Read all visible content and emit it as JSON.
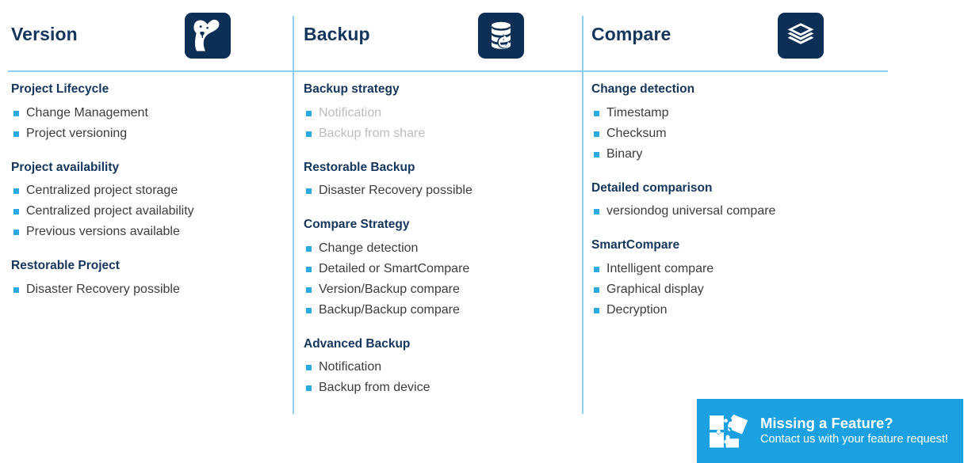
{
  "colors": {
    "heading_navy": "#14365c",
    "bullet_cyan": "#29aae1",
    "divider_blue": "#8ed0f2",
    "banner_blue": "#1ba1e2",
    "icon_tile_navy": "#0c2f55",
    "body_text": "#3c3c3c",
    "dim_text": "#bdbdbd"
  },
  "columns": [
    {
      "title": "Version",
      "icon": "versiondog-dog-icon",
      "groups": [
        {
          "title": "Project Lifecycle",
          "items": [
            {
              "label": "Change Management",
              "dim": false
            },
            {
              "label": "Project versioning",
              "dim": false
            }
          ]
        },
        {
          "title": "Project availability",
          "items": [
            {
              "label": "Centralized project storage",
              "dim": false
            },
            {
              "label": "Centralized project availability",
              "dim": false
            },
            {
              "label": "Previous versions available",
              "dim": false
            }
          ]
        },
        {
          "title": "Restorable Project",
          "items": [
            {
              "label": "Disaster Recovery possible",
              "dim": false
            }
          ]
        }
      ]
    },
    {
      "title": "Backup",
      "icon": "database-restore-icon",
      "groups": [
        {
          "title": "Backup strategy",
          "items": [
            {
              "label": "Notification",
              "dim": true
            },
            {
              "label": "Backup from share",
              "dim": true
            }
          ]
        },
        {
          "title": "Restorable Backup",
          "items": [
            {
              "label": "Disaster Recovery possible",
              "dim": false
            }
          ]
        },
        {
          "title": "Compare Strategy",
          "items": [
            {
              "label": "Change detection",
              "dim": false
            },
            {
              "label": "Detailed or SmartCompare",
              "dim": false
            },
            {
              "label": "Version/Backup compare",
              "dim": false
            },
            {
              "label": "Backup/Backup compare",
              "dim": false
            }
          ]
        },
        {
          "title": "Advanced Backup",
          "items": [
            {
              "label": "Notification",
              "dim": false
            },
            {
              "label": "Backup from device",
              "dim": false
            }
          ]
        }
      ]
    },
    {
      "title": "Compare",
      "icon": "layers-stack-icon",
      "groups": [
        {
          "title": "Change detection",
          "items": [
            {
              "label": "Timestamp",
              "dim": false
            },
            {
              "label": "Checksum",
              "dim": false
            },
            {
              "label": "Binary",
              "dim": false
            }
          ]
        },
        {
          "title": "Detailed comparison",
          "items": [
            {
              "label": "versiondog universal compare",
              "dim": false
            }
          ]
        },
        {
          "title": "SmartCompare",
          "items": [
            {
              "label": "Intelligent compare",
              "dim": false
            },
            {
              "label": "Graphical display",
              "dim": false
            },
            {
              "label": "Decryption",
              "dim": false
            }
          ]
        }
      ]
    }
  ],
  "feature_banner": {
    "icon": "puzzle-pieces-icon",
    "title": "Missing a Feature?",
    "subtitle": "Contact us with your feature request!"
  }
}
